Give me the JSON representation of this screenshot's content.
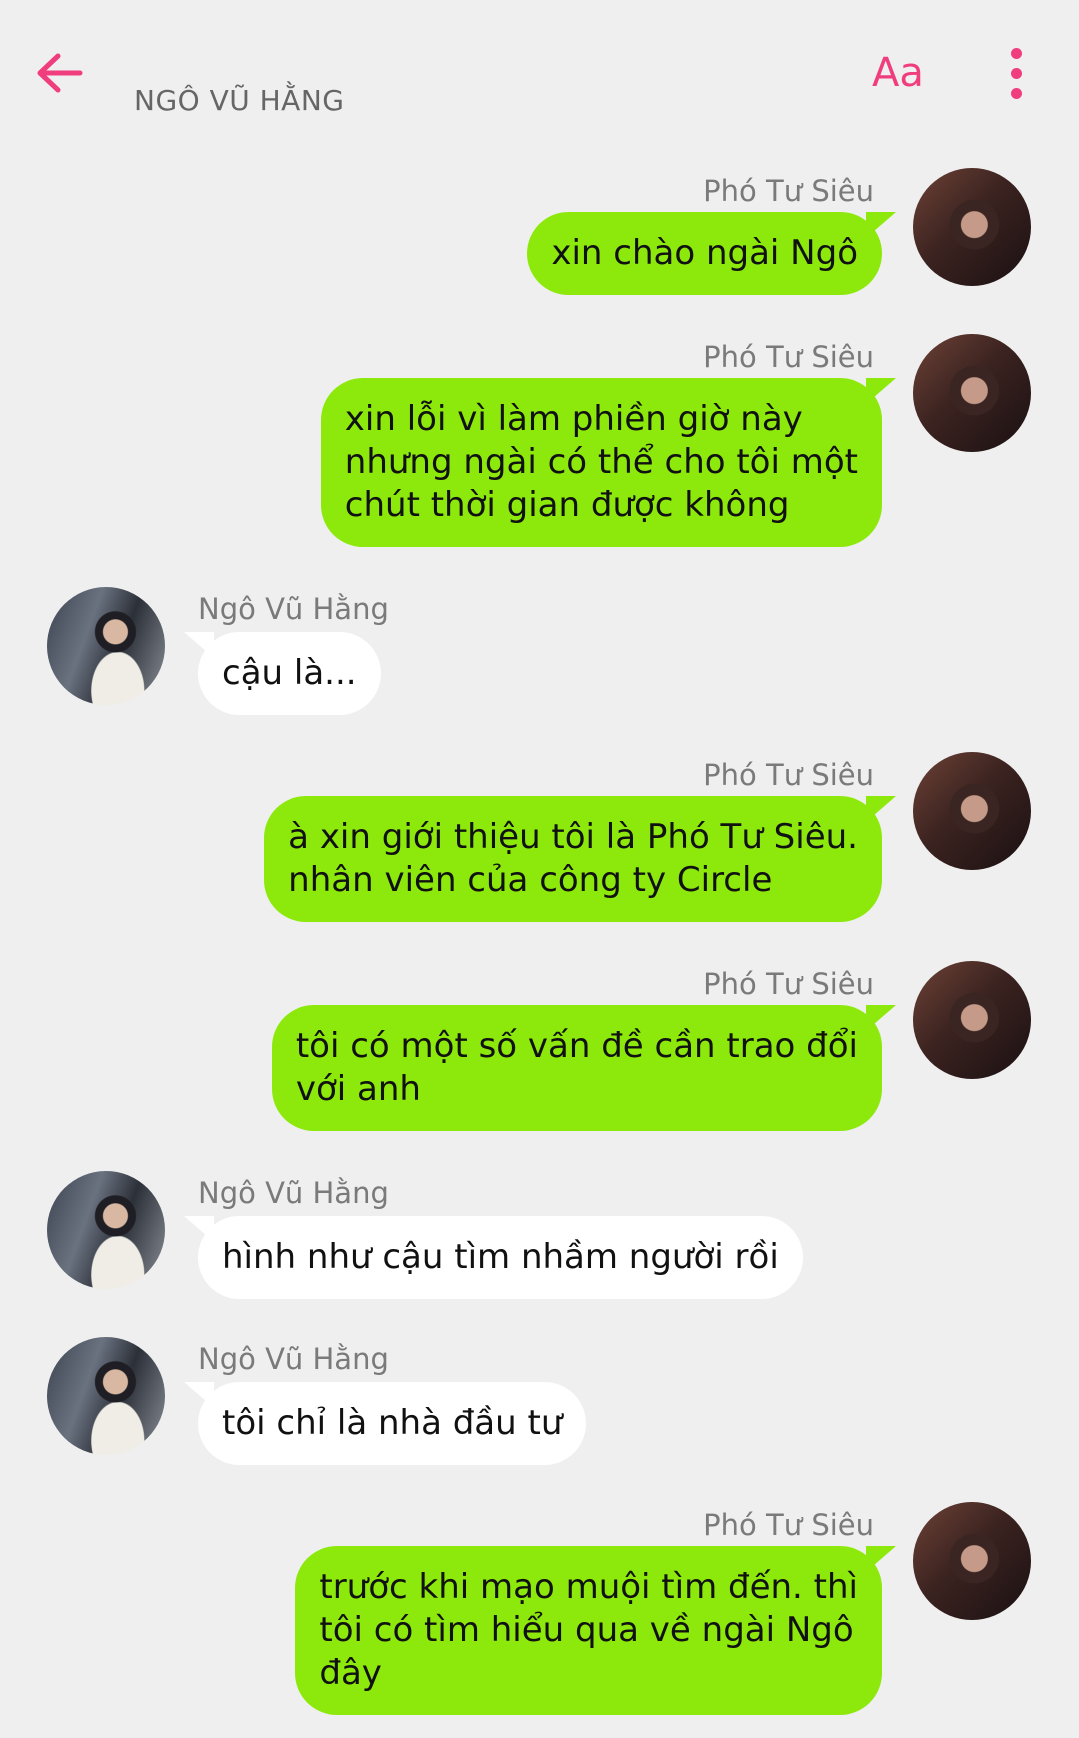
{
  "header": {
    "title": "NGÔ VŨ HẰNG",
    "font_label": "Aa",
    "back_icon": "arrow-left-icon",
    "more_icon": "more-vertical-icon",
    "accent_color": "#ef3d7e"
  },
  "colors": {
    "background": "#efefef",
    "outgoing_bubble": "#8ce90b",
    "incoming_bubble": "#ffffff"
  },
  "messages": [
    {
      "sender": "Phó Tư Siêu",
      "side": "right",
      "lines": [
        "xin chào ngài Ngô"
      ]
    },
    {
      "sender": "Phó Tư Siêu",
      "side": "right",
      "lines": [
        "xin lỗi vì làm phiền giờ này",
        "nhưng ngài có thể cho tôi một",
        "chút thời gian được không"
      ]
    },
    {
      "sender": "Ngô Vũ Hằng",
      "side": "left",
      "lines": [
        "cậu là..."
      ]
    },
    {
      "sender": "Phó Tư Siêu",
      "side": "right",
      "lines": [
        "à xin giới thiệu tôi là Phó Tư Siêu.",
        "nhân viên của công ty Circle"
      ]
    },
    {
      "sender": "Phó Tư Siêu",
      "side": "right",
      "lines": [
        "tôi có một số vấn đề cần trao đổi",
        "với anh"
      ]
    },
    {
      "sender": "Ngô Vũ Hằng",
      "side": "left",
      "lines": [
        "hình như cậu tìm nhầm người rồi"
      ]
    },
    {
      "sender": "Ngô Vũ Hằng",
      "side": "left",
      "lines": [
        "tôi chỉ là nhà đầu tư"
      ]
    },
    {
      "sender": "Phó Tư Siêu",
      "side": "right",
      "lines": [
        "trước khi mạo muội tìm đến. thì",
        "tôi có tìm hiểu qua về ngài Ngô",
        "đây"
      ]
    }
  ]
}
